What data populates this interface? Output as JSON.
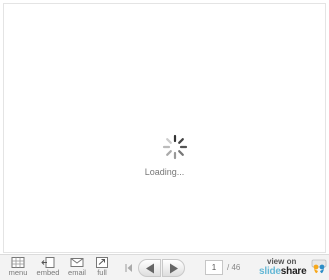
{
  "viewer": {
    "loading_text": "Loading...",
    "toolbar": {
      "menu_label": "menu",
      "embed_label": "embed",
      "email_label": "email",
      "full_label": "full"
    },
    "pager": {
      "current_page": "1",
      "total_pages": "/ 46"
    },
    "view_on": {
      "prefix": "view on",
      "brand_part1": "slide",
      "brand_part2": "share"
    },
    "colors": {
      "brand_blue": "#66b9d6",
      "brand_dark": "#222222",
      "logo_orange": "#f7a81b",
      "logo_blue": "#2e8ec7"
    },
    "icons": [
      "menu-icon",
      "embed-icon",
      "email-icon",
      "fullscreen-icon",
      "first-slide-icon",
      "prev-arrow-icon",
      "next-arrow-icon",
      "slideshare-logo-icon",
      "loading-spinner-icon"
    ]
  }
}
